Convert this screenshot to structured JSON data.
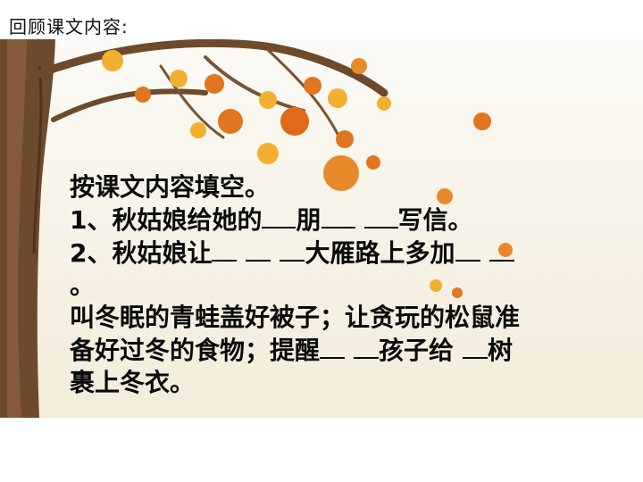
{
  "header": {
    "title": "回顾课文内容:"
  },
  "content": {
    "heading": "按课文内容填空。",
    "q1": {
      "p1": "1、秋姑娘给她的",
      "p2": "朋",
      "p3": "写信。"
    },
    "q2": {
      "p1": "2、秋姑娘让",
      "p2": "大雁路上多加",
      "p3": "。",
      "p4": "叫冬眠的青蛙盖好被子；让贪玩的松鼠准",
      "p5": "备好过冬的食物；提醒",
      "p6": "孩子给",
      "p7": "树",
      "p8": "裹上冬衣。"
    }
  },
  "colors": {
    "text": "#0b0b0b",
    "leaf_orange": "#e0761f",
    "leaf_yellow": "#f2b030",
    "bark": "#6e4a2c"
  }
}
